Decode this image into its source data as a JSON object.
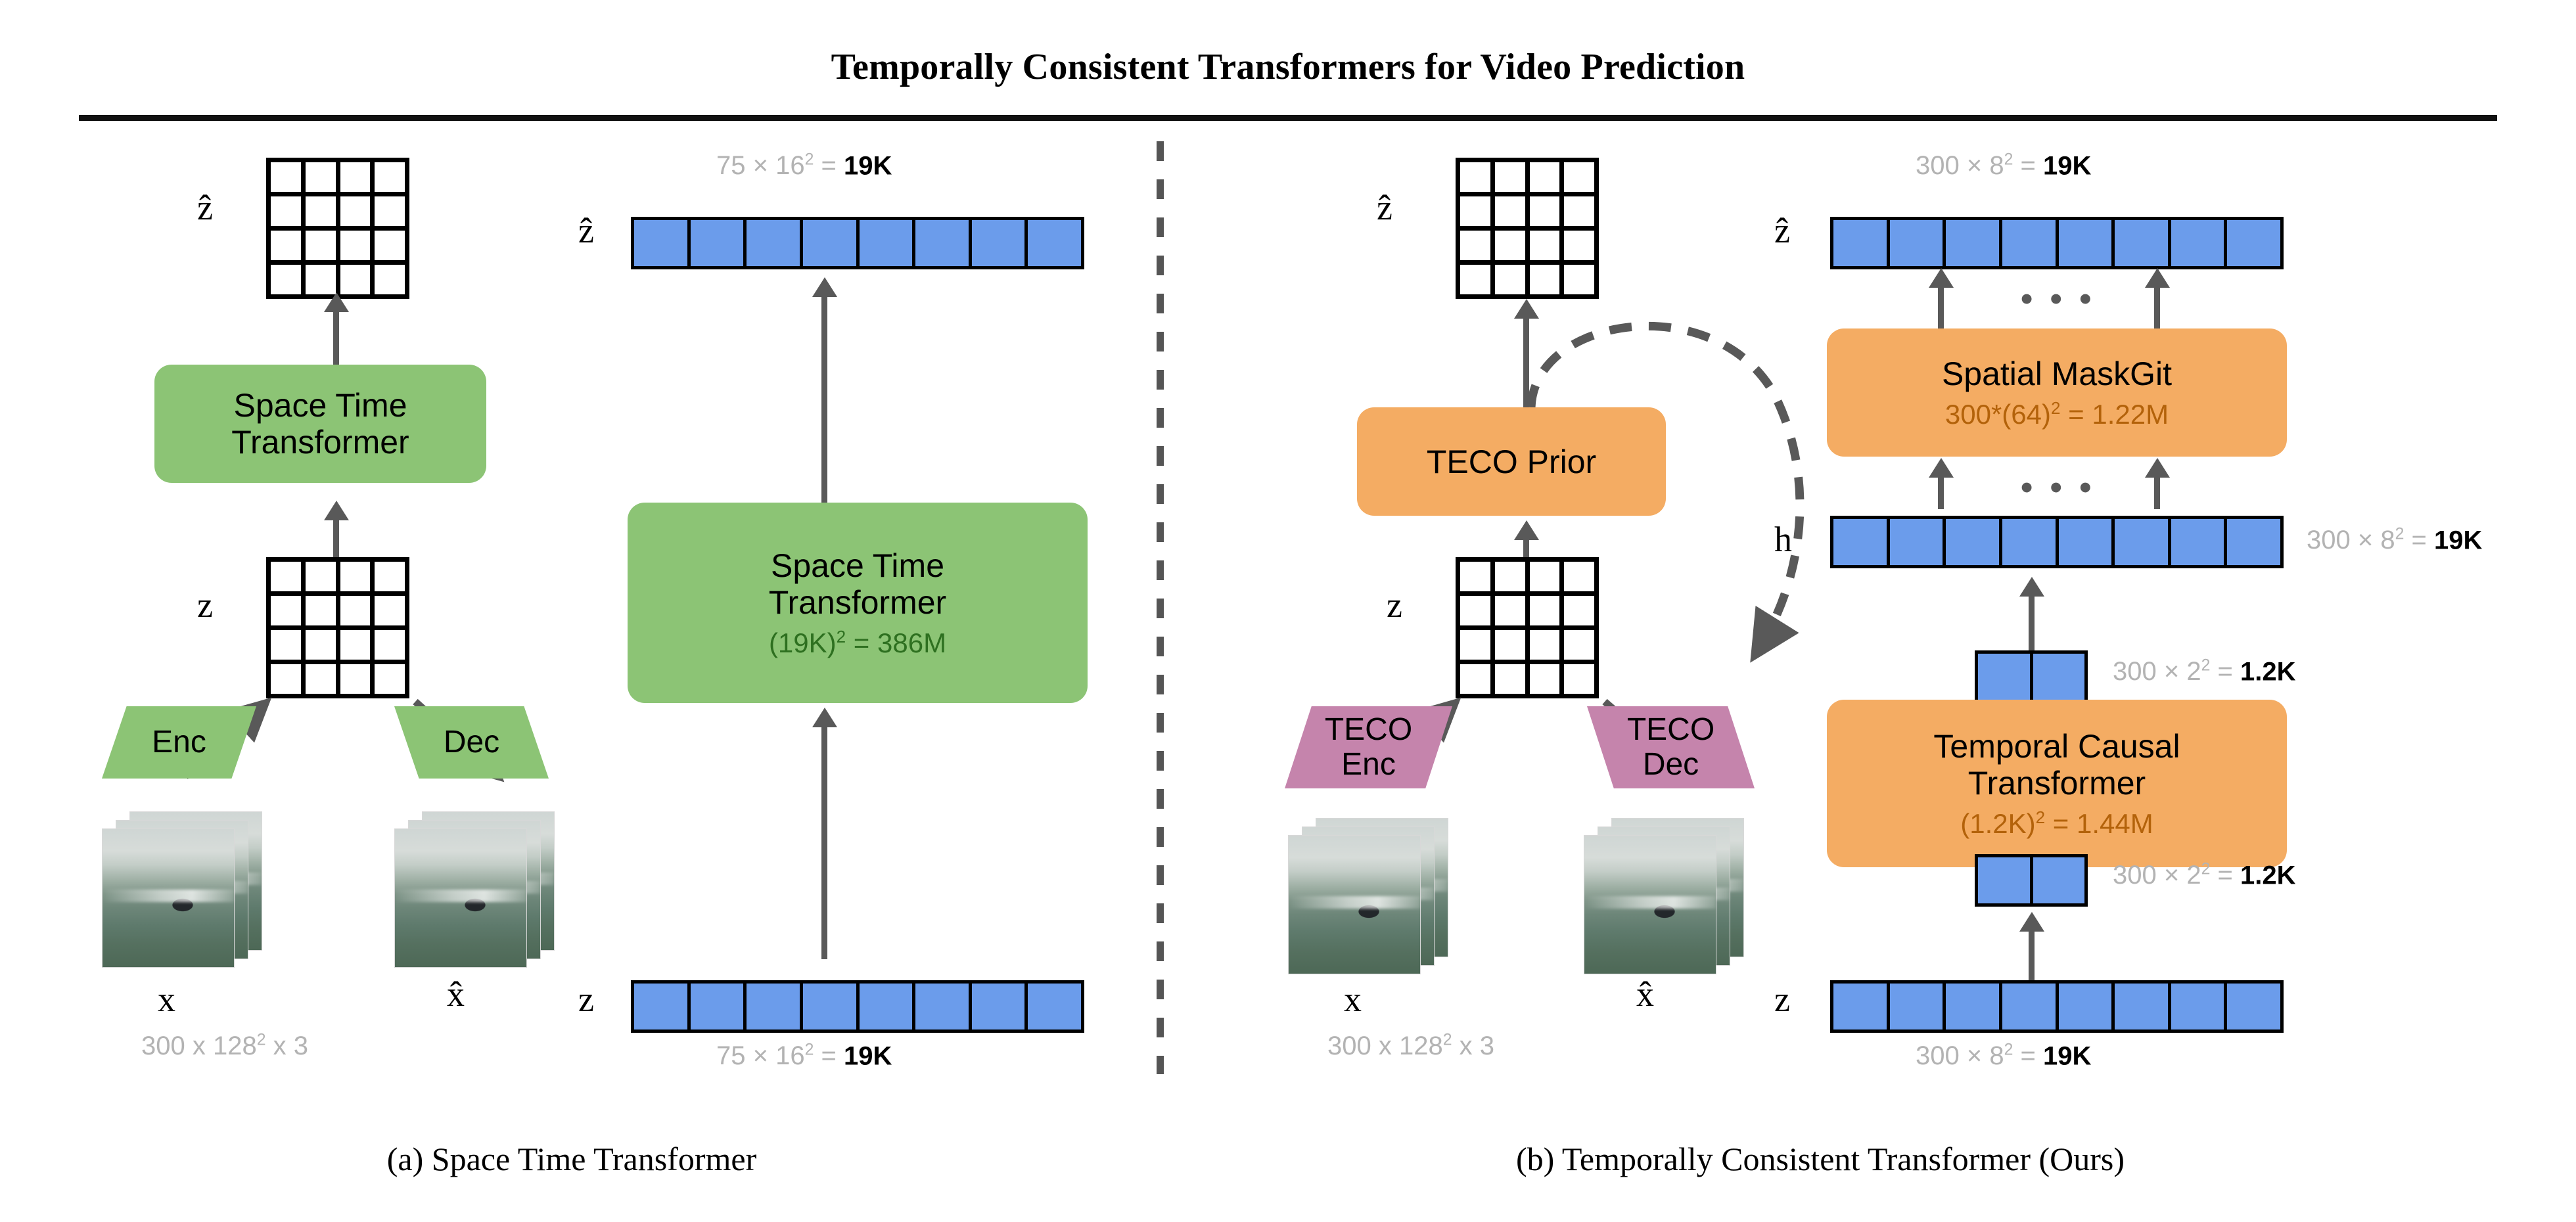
{
  "figure": {
    "title": "Temporally Consistent Transformers for Video Prediction"
  },
  "panel_a": {
    "caption": "(a) Space Time Transformer",
    "left_column": {
      "zhat_label": "ẑ",
      "z_label": "z",
      "transformer_box": {
        "title_line1": "Space Time",
        "title_line2": "Transformer"
      },
      "encoder_label": "Enc",
      "decoder_label": "Dec",
      "x_label": "x",
      "xhat_label": "x̂",
      "input_dims": "300 x 128² x 3"
    },
    "right_column": {
      "zhat_label": "ẑ",
      "z_label": "z",
      "top_dims_gray": "75 × 16² = ",
      "top_dims_bold": "19K",
      "bottom_dims_gray": "75 × 16² = ",
      "bottom_dims_bold": "19K",
      "transformer_box": {
        "title_line1": "Space Time",
        "title_line2": "Transformer",
        "subtitle": "(19K)² = 386M"
      },
      "num_tokens_top": 8,
      "num_tokens_bottom": 8
    }
  },
  "panel_b": {
    "caption": "(b) Temporally Consistent Transformer (Ours)",
    "left_column": {
      "zhat_label": "ẑ",
      "z_label": "z",
      "prior_box": {
        "title": "TECO Prior"
      },
      "encoder_label_line1": "TECO",
      "encoder_label_line2": "Enc",
      "decoder_label_line1": "TECO",
      "decoder_label_line2": "Dec",
      "x_label": "x",
      "xhat_label": "x̂",
      "input_dims": "300 x 128² x 3"
    },
    "right_column": {
      "zhat_label": "ẑ",
      "h_label": "h",
      "z_label": "z",
      "zhat_dims_gray": "300 × 8² = ",
      "zhat_dims_bold": "19K",
      "h_dims_gray": "300 × 8² = ",
      "h_dims_bold": "19K",
      "mid_top_dims_gray": "300 × 2² = ",
      "mid_top_dims_bold": "1.2K",
      "mid_bottom_dims_gray": "300 × 2² = ",
      "mid_bottom_dims_bold": "1.2K",
      "z_dims_gray": "300 × 8² = ",
      "z_dims_bold": "19K",
      "maskgit_box": {
        "title": "Spatial MaskGit",
        "subtitle": "300*(64)² = 1.22M"
      },
      "causal_box": {
        "title_line1": "Temporal Causal",
        "title_line2": "Transformer",
        "subtitle": "(1.2K)² = 1.44M"
      },
      "ellipsis": "• • •",
      "num_tokens_zhat": 8,
      "num_tokens_h": 8,
      "num_tokens_z": 8,
      "num_tokens_mid": 2
    }
  },
  "colors": {
    "green_fill": "#8cc475",
    "green_text": "#2e7020",
    "orange_fill": "#f4ac63",
    "orange_text": "#b3620a",
    "pink_fill": "#c584ac",
    "blue_token": "#6b9ceb",
    "arrow_gray": "#595959",
    "dim_gray": "#b3b3b3"
  }
}
